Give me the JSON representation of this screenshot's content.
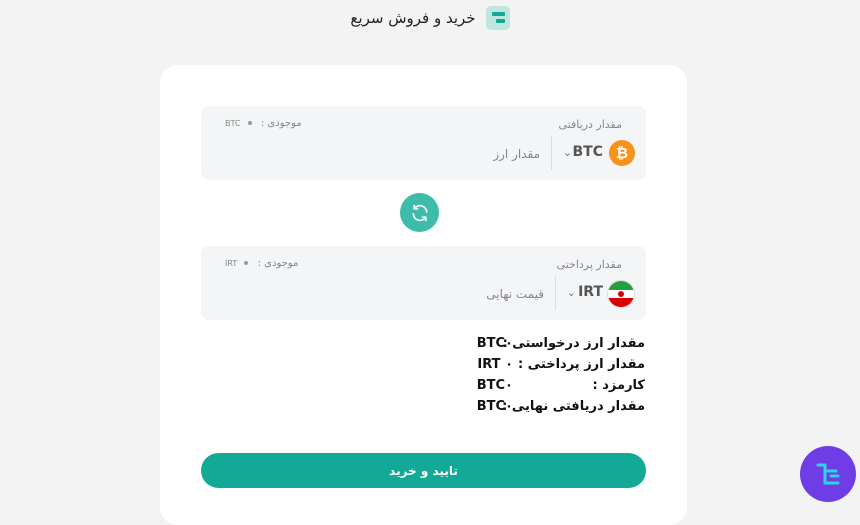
{
  "header": {
    "title": "خرید و فروش سریع",
    "logo_icon": "exchange-logo-icon"
  },
  "receive": {
    "label": "مقدار دریافتی",
    "balance_label": "موجودی :",
    "balance_value": "۰",
    "balance_currency": "BTC",
    "currency_symbol": "BTC",
    "coin_glyph": "₿",
    "amount_placeholder": "مقدار ارز"
  },
  "swap_icon": "swap-arrows-icon",
  "pay": {
    "label": "مقدار پرداختی",
    "balance_label": "موجودی :",
    "balance_value": "۰",
    "balance_currency": "IRT",
    "currency_symbol": "IRT",
    "amount_placeholder": "قیمت نهایی"
  },
  "summary": [
    {
      "label": "مقدار ارز درخواستی :",
      "value": "BTC۰"
    },
    {
      "label": "مقدار ارز پرداختی :",
      "value": "IRT ۰"
    },
    {
      "label": "کارمزد :",
      "value": "BTC۰"
    },
    {
      "label": "مقدار دریافتی نهایی :",
      "value": "BTC۰"
    }
  ],
  "confirm_label": "تایید و خرید",
  "colors": {
    "accent": "#12aa96",
    "swap": "#3dbca9",
    "btc": "#f7931a",
    "badge": "#6f3de6"
  }
}
